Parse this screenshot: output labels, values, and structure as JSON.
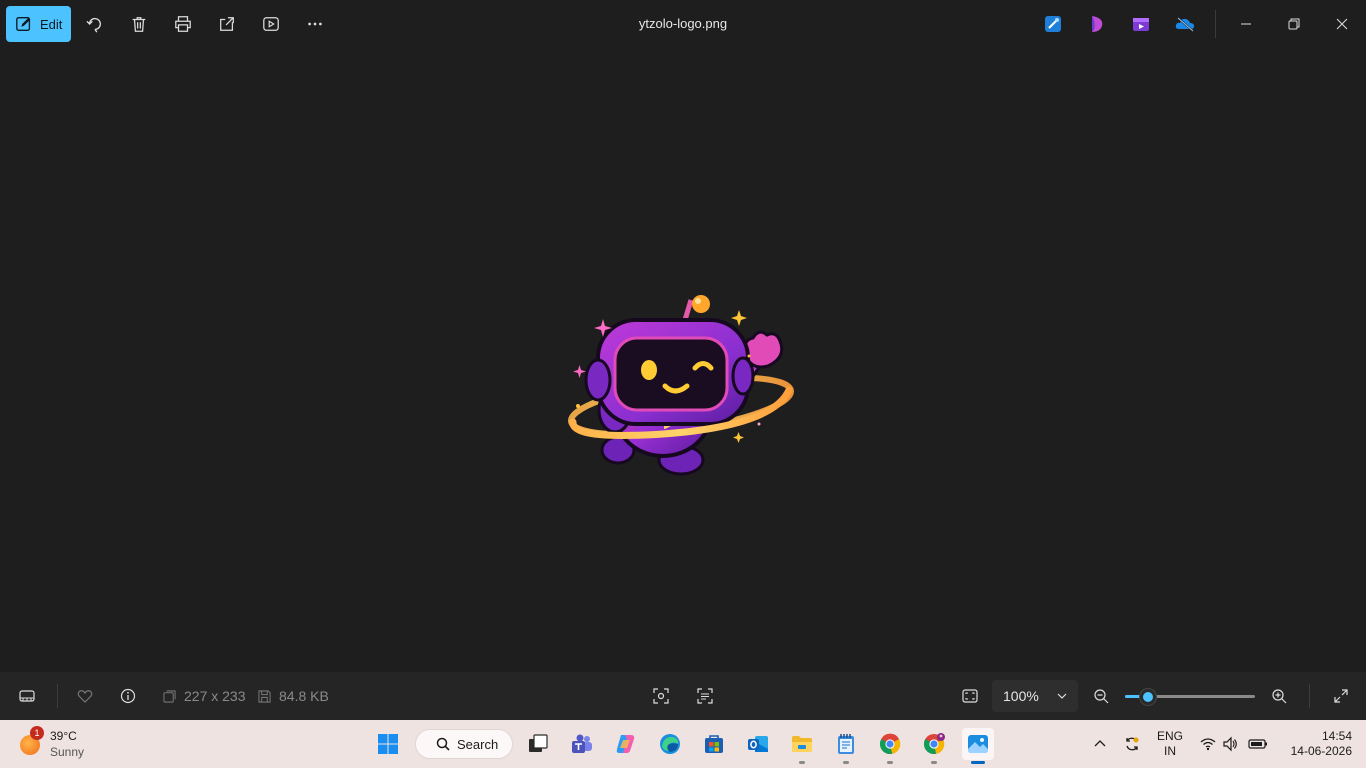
{
  "toolbar": {
    "edit_label": "Edit",
    "file_name": "ytzolo-logo.png",
    "icons": [
      "edit-icon",
      "rotate-icon",
      "delete-icon",
      "print-icon",
      "share-icon",
      "slideshow-icon",
      "more-icon"
    ],
    "app_icons": [
      "designer-icon",
      "clipchamp-icon",
      "video-editor-icon",
      "onedrive-icon"
    ],
    "window_controls": [
      "minimize-icon",
      "restore-icon",
      "close-icon"
    ]
  },
  "status_bar": {
    "dimensions": "227 x 233",
    "file_size": "84.8 KB",
    "zoom_value": "100%",
    "zoom_level": 0.18,
    "accent_color": "#4cc2ff"
  },
  "weather": {
    "badge": "1",
    "temperature": "39°C",
    "condition": "Sunny"
  },
  "taskbar": {
    "search_label": "Search",
    "apps": [
      "start",
      "search",
      "task-view",
      "teams",
      "copilot",
      "edge",
      "store",
      "outlook",
      "file-explorer",
      "notepad",
      "chrome",
      "chrome-profile",
      "photos"
    ],
    "active_app": "photos"
  },
  "tray": {
    "lang_primary": "ENG",
    "lang_secondary": "IN",
    "time": "14:54",
    "date": "14-06-2026"
  }
}
